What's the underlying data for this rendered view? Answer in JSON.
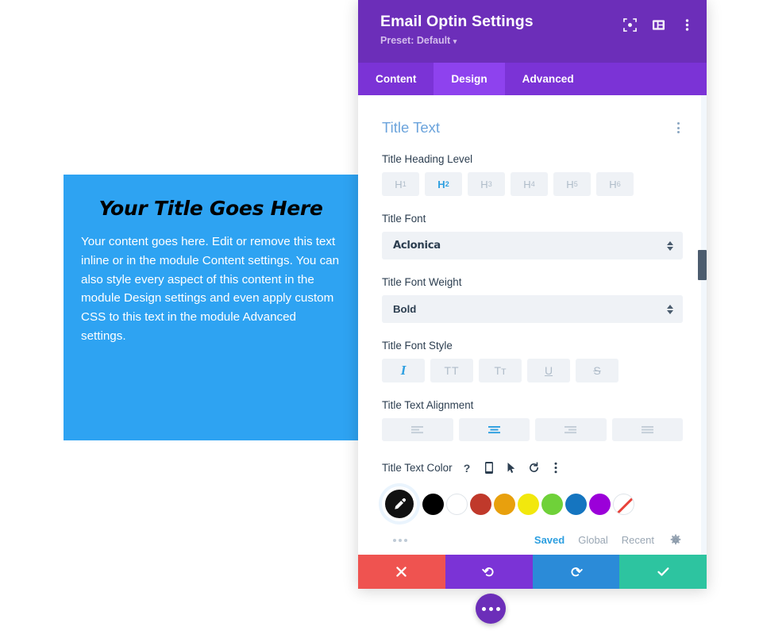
{
  "preview": {
    "title": "Your Title Goes Here",
    "body": "Your content goes here. Edit or remove this text inline or in the module Content settings. You can also style every aspect of this content in the module Design settings and even apply custom CSS to this text in the module Advanced settings.",
    "background_color": "#2EA3F2",
    "title_color": "#000000",
    "body_color": "#FFFFFF"
  },
  "panel": {
    "title": "Email Optin Settings",
    "preset_label": "Preset: Default",
    "preset_caret": "▾",
    "header_color": "#6C2EB9",
    "header_icons": [
      {
        "name": "focus-target-icon"
      },
      {
        "name": "layout-panel-icon"
      },
      {
        "name": "more-options-icon"
      }
    ],
    "tabs": [
      {
        "label": "Content",
        "active": false
      },
      {
        "label": "Design",
        "active": true
      },
      {
        "label": "Advanced",
        "active": false
      }
    ],
    "active_tab_color": "#8E42EE"
  },
  "section": {
    "title": "Title Text",
    "title_color": "#6CA4DC"
  },
  "heading_level": {
    "label": "Title Heading Level",
    "options": [
      {
        "letter": "H",
        "number": "1",
        "active": false
      },
      {
        "letter": "H",
        "number": "2",
        "active": true
      },
      {
        "letter": "H",
        "number": "3",
        "active": false
      },
      {
        "letter": "H",
        "number": "4",
        "active": false
      },
      {
        "letter": "H",
        "number": "5",
        "active": false
      },
      {
        "letter": "H",
        "number": "6",
        "active": false
      }
    ]
  },
  "title_font": {
    "label": "Title Font",
    "value": "Aclonica"
  },
  "title_font_weight": {
    "label": "Title Font Weight",
    "value": "Bold"
  },
  "font_style": {
    "label": "Title Font Style",
    "options": [
      {
        "glyph": "I",
        "name": "italic",
        "active": true
      },
      {
        "glyph": "TT",
        "name": "uppercase",
        "active": false
      },
      {
        "glyph": "Tᴛ",
        "name": "small-caps",
        "active": false
      },
      {
        "glyph": "U",
        "name": "underline",
        "active": false
      },
      {
        "glyph": "S",
        "name": "strikethrough",
        "active": false
      }
    ]
  },
  "text_alignment": {
    "label": "Title Text Alignment",
    "options": [
      {
        "name": "align-left",
        "active": false
      },
      {
        "name": "align-center",
        "active": true
      },
      {
        "name": "align-right",
        "active": false
      },
      {
        "name": "align-justify",
        "active": false
      }
    ],
    "active_color": "#2D9FE0"
  },
  "text_color": {
    "label": "Title Text Color",
    "row_icons": [
      {
        "name": "help-icon",
        "glyph": "?"
      },
      {
        "name": "responsive-mobile-icon"
      },
      {
        "name": "hover-cursor-icon"
      },
      {
        "name": "reset-icon"
      },
      {
        "name": "more-options-icon"
      }
    ],
    "picker": {
      "name": "eyedropper-picker",
      "color": "#111111"
    },
    "swatches": [
      {
        "name": "swatch-black",
        "color": "#000000"
      },
      {
        "name": "swatch-white",
        "color": "#FFFFFF"
      },
      {
        "name": "swatch-red",
        "color": "#C0392B"
      },
      {
        "name": "swatch-orange",
        "color": "#E8A00D"
      },
      {
        "name": "swatch-yellow",
        "color": "#F2E80D"
      },
      {
        "name": "swatch-green",
        "color": "#6FD139"
      },
      {
        "name": "swatch-blue",
        "color": "#1575C0"
      },
      {
        "name": "swatch-purple",
        "color": "#9B00D9"
      },
      {
        "name": "swatch-transparent",
        "color": "transparent"
      }
    ],
    "footer": {
      "links": [
        {
          "label": "Saved",
          "active": true
        },
        {
          "label": "Global",
          "active": false
        },
        {
          "label": "Recent",
          "active": false
        }
      ],
      "gear_name": "settings-gear-icon"
    }
  },
  "footer_actions": [
    {
      "name": "cancel-button",
      "icon": "close-icon",
      "color": "#EF5350"
    },
    {
      "name": "undo-button",
      "icon": "undo-icon",
      "color": "#7B33D6"
    },
    {
      "name": "redo-button",
      "icon": "redo-icon",
      "color": "#2B8BD8"
    },
    {
      "name": "save-button",
      "icon": "check-icon",
      "color": "#2DC4A0"
    }
  ],
  "fab": {
    "name": "floating-menu-button",
    "color": "#6C2EB9"
  }
}
